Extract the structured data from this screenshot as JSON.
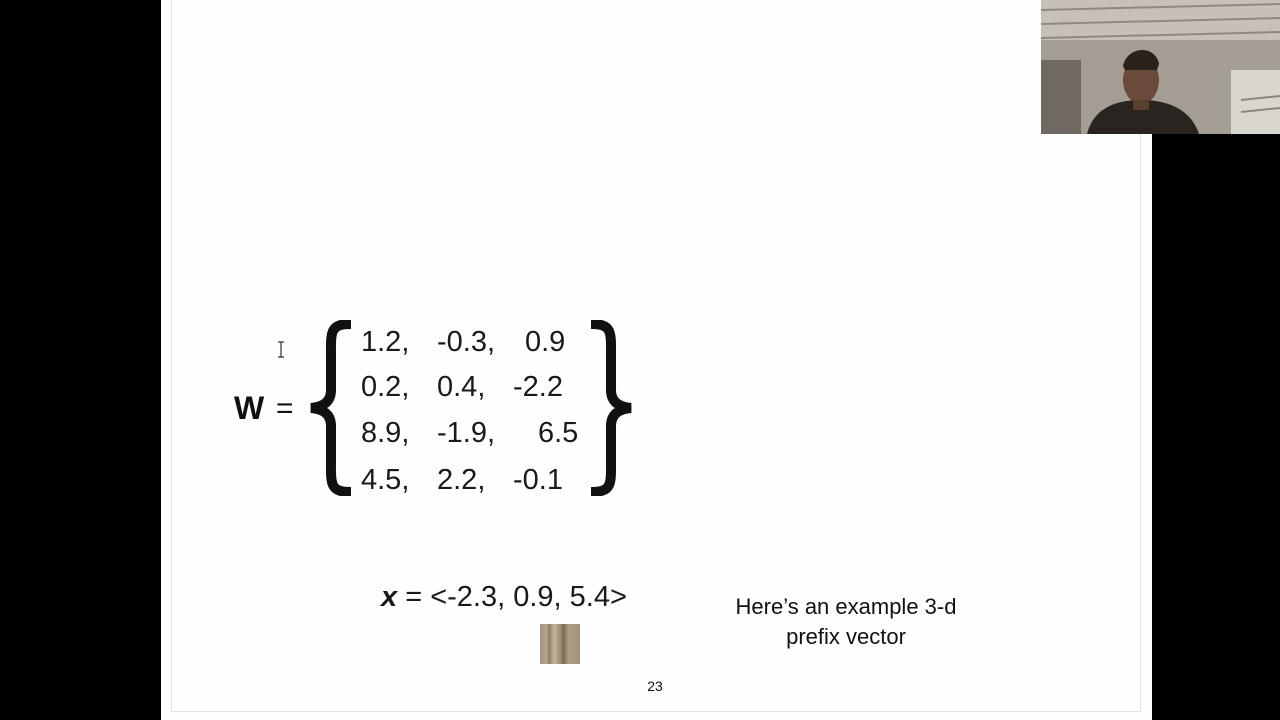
{
  "slide": {
    "matrix": {
      "label": "W",
      "equals": "=",
      "rows": [
        [
          "1.2,",
          "-0.3,",
          "0.9"
        ],
        [
          "0.2,",
          "0.4,",
          "-2.2"
        ],
        [
          "8.9,",
          "-1.9,",
          "6.5"
        ],
        [
          "4.5,",
          "2.2,",
          "-0.1"
        ]
      ]
    },
    "vector": {
      "label": "x",
      "equals": "=",
      "value": "<-2.3, 0.9, 5.4>"
    },
    "note": {
      "line1": "Here’s an example 3-d",
      "line2": "prefix vector"
    },
    "page_number": "23"
  },
  "icons": {
    "cursor": "text-cursor-icon",
    "webcam": "webcam-video-feed"
  },
  "colors": {
    "background": "#000000",
    "slide": "#fefefe",
    "text": "#111111",
    "swatch": "#a9957f"
  }
}
